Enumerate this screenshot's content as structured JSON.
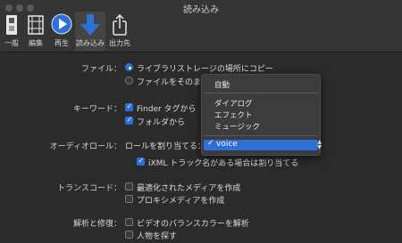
{
  "window": {
    "title": "読み込み"
  },
  "toolbar": {
    "items": [
      {
        "label": "一般",
        "icon": "switch-icon"
      },
      {
        "label": "編集",
        "icon": "film-strip-icon"
      },
      {
        "label": "再生",
        "icon": "play-icon"
      },
      {
        "label": "読み込み",
        "icon": "import-arrow-icon",
        "selected": true
      },
      {
        "label": "出力先",
        "icon": "share-icon"
      }
    ]
  },
  "file": {
    "label": "ファイル：",
    "option_copy": "ライブラリストレージの場所にコピー",
    "option_leave": "ファイルをそのま"
  },
  "keywords": {
    "label": "キーワード：",
    "finder_tags": "Finder タグから",
    "folders": "フォルダから"
  },
  "audio_roles": {
    "label": "オーディオロール：",
    "assign_text": "ロールを割り当てる：",
    "ixml_text": "iXML トラック名がある場合は割り当てる"
  },
  "role_menu": {
    "items": [
      "自動",
      "ダイアログ",
      "エフェクト",
      "ミュージック"
    ],
    "selected": "voice"
  },
  "transcode": {
    "label": "トランスコード：",
    "optimized": "最適化されたメディアを作成",
    "proxy": "プロキシメディアを作成"
  },
  "analyze": {
    "label": "解析と修復：",
    "balance": "ビデオのバランスカラーを解析",
    "people": "人物を探す"
  },
  "colors": {
    "accent": "#2f6fd8",
    "background": "#2b2b2b"
  }
}
